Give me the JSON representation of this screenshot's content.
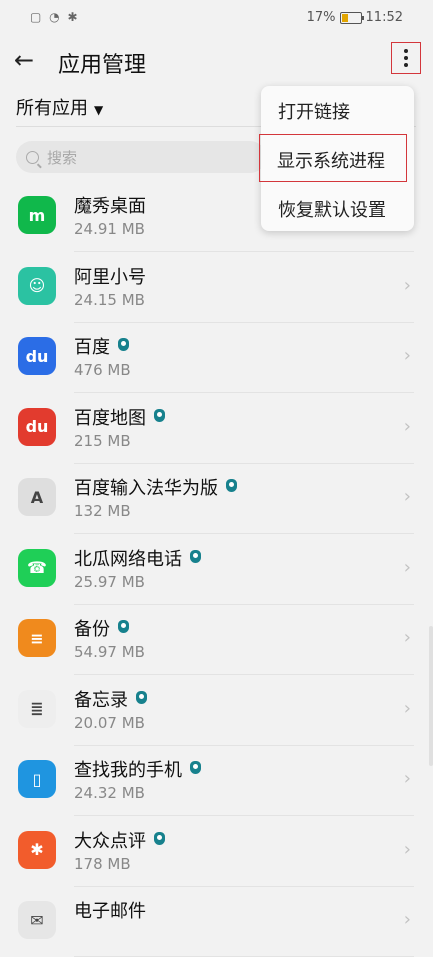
{
  "status": {
    "battery": "17%",
    "time": "11:52"
  },
  "appbar": {
    "title": "应用管理"
  },
  "filter": {
    "label": "所有应用"
  },
  "search": {
    "placeholder": "搜索"
  },
  "menu": {
    "items": [
      "打开链接",
      "显示系统进程",
      "恢复默认设置"
    ],
    "highlighted_index": 1
  },
  "apps": [
    {
      "name": "魔秀桌面",
      "size": "24.91 MB",
      "icon": "moxiu-icon",
      "color": "#10b84b",
      "glyph": "m",
      "verified": false
    },
    {
      "name": "阿里小号",
      "size": "24.15 MB",
      "icon": "alixiaohao-icon",
      "color": "#2bc2a2",
      "glyph": "☺",
      "verified": false
    },
    {
      "name": "百度",
      "size": "476 MB",
      "icon": "baidu-icon",
      "color": "#2b6de6",
      "glyph": "du",
      "verified": true
    },
    {
      "name": "百度地图",
      "size": "215 MB",
      "icon": "baidu-map-icon",
      "color": "#e23b2e",
      "glyph": "du",
      "verified": true
    },
    {
      "name": "百度输入法华为版",
      "size": "132 MB",
      "icon": "baidu-input-icon",
      "color": "#dedede",
      "glyph": "A",
      "verified": true
    },
    {
      "name": "北瓜网络电话",
      "size": "25.97 MB",
      "icon": "phone-icon",
      "color": "#1fcf57",
      "glyph": "☎",
      "verified": true
    },
    {
      "name": "备份",
      "size": "54.97 MB",
      "icon": "backup-icon",
      "color": "#f08a1d",
      "glyph": "≡",
      "verified": true
    },
    {
      "name": "备忘录",
      "size": "20.07 MB",
      "icon": "memo-icon",
      "color": "#eeeeee",
      "glyph": "≣",
      "verified": true
    },
    {
      "name": "查找我的手机",
      "size": "24.32 MB",
      "icon": "find-phone-icon",
      "color": "#1f95e0",
      "glyph": "▯",
      "verified": true
    },
    {
      "name": "大众点评",
      "size": "178 MB",
      "icon": "dianping-icon",
      "color": "#f25c2c",
      "glyph": "✱",
      "verified": true
    },
    {
      "name": "电子邮件",
      "size": "",
      "icon": "email-icon",
      "color": "#e6e6e6",
      "glyph": "✉",
      "verified": false
    }
  ]
}
